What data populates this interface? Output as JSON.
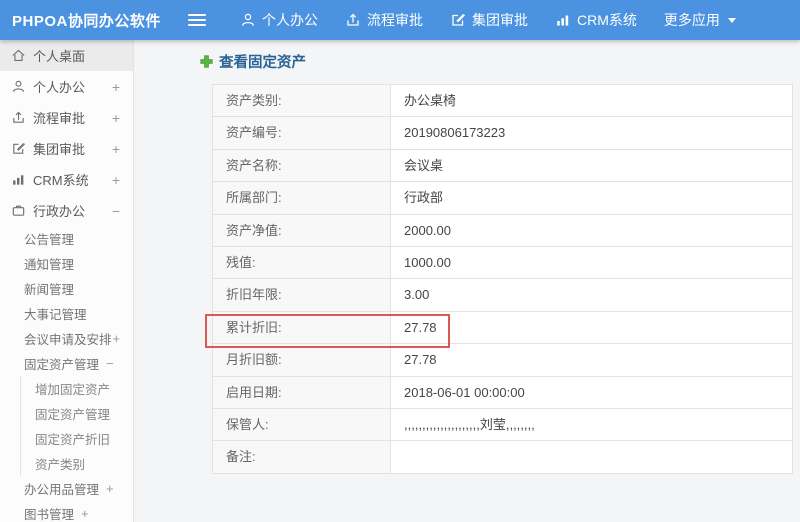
{
  "colors": {
    "topbar_blue": "#4b93e1",
    "title_blue": "#2a6496",
    "highlight_red": "#d95a52",
    "plus_green": "#57b647"
  },
  "app": {
    "title": "PHPOA协同办公软件"
  },
  "topbar": {
    "items": [
      {
        "label": "个人办公",
        "icon": "person-icon"
      },
      {
        "label": "流程审批",
        "icon": "flow-icon"
      },
      {
        "label": "集团审批",
        "icon": "edit-icon"
      },
      {
        "label": "CRM系统",
        "icon": "bar-chart-icon"
      },
      {
        "label": "更多应用",
        "icon": "caret-down-icon"
      }
    ]
  },
  "sidebar": {
    "items": [
      {
        "label": "个人桌面",
        "icon": "home-icon",
        "expand": ""
      },
      {
        "label": "个人办公",
        "icon": "person-icon",
        "expand": "+"
      },
      {
        "label": "流程审批",
        "icon": "flow-icon",
        "expand": "+"
      },
      {
        "label": "集团审批",
        "icon": "edit-icon",
        "expand": "+"
      },
      {
        "label": "CRM系统",
        "icon": "bar-chart-icon",
        "expand": "+"
      },
      {
        "label": "行政办公",
        "icon": "briefcase-icon",
        "expand": "−"
      }
    ],
    "submenu": [
      {
        "label": "公告管理",
        "expand": ""
      },
      {
        "label": "通知管理",
        "expand": ""
      },
      {
        "label": "新闻管理",
        "expand": ""
      },
      {
        "label": "大事记管理",
        "expand": ""
      },
      {
        "label": "会议申请及安排",
        "expand": "+"
      },
      {
        "label": "固定资产管理",
        "expand": "−"
      }
    ],
    "asset_submenu": [
      {
        "label": "增加固定资产"
      },
      {
        "label": "固定资产管理"
      },
      {
        "label": "固定资产折旧"
      },
      {
        "label": "资产类别"
      }
    ],
    "submenu_tail": [
      {
        "label": "办公用品管理",
        "expand": "+"
      },
      {
        "label": "图书管理",
        "expand": "+"
      }
    ]
  },
  "main": {
    "title": "查看固定资产",
    "rows": [
      {
        "label": "资产类别:",
        "value": "办公桌椅"
      },
      {
        "label": "资产编号:",
        "value": "20190806173223"
      },
      {
        "label": "资产名称:",
        "value": "会议桌"
      },
      {
        "label": "所属部门:",
        "value": "行政部"
      },
      {
        "label": "资产净值:",
        "value": "2000.00"
      },
      {
        "label": "残值:",
        "value": "1000.00"
      },
      {
        "label": "折旧年限:",
        "value": "3.00"
      },
      {
        "label": "累计折旧:",
        "value": "27.78",
        "highlighted": true
      },
      {
        "label": "月折旧额:",
        "value": "27.78"
      },
      {
        "label": "启用日期:",
        "value": "2018-06-01 00:00:00"
      },
      {
        "label": "保管人:",
        "value": ",,,,,,,,,,,,,,,,,,,,,刘莹,,,,,,,,"
      },
      {
        "label": "备注:",
        "value": ""
      }
    ]
  }
}
